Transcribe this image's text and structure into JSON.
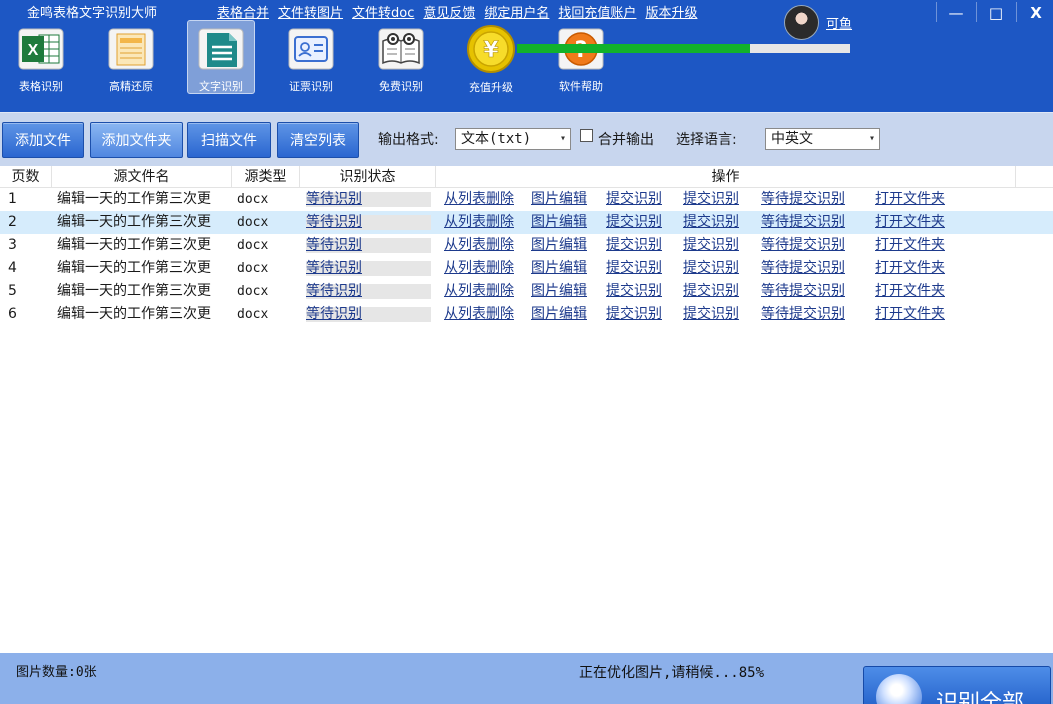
{
  "app_title": "金鸣表格文字识别大师",
  "top_links": [
    "表格合并",
    "文件转图片",
    "文件转doc",
    "意见反馈",
    "绑定用户名",
    "找回充值账户",
    "版本升级"
  ],
  "user": {
    "name": "可鱼"
  },
  "window_controls": {
    "minimize": "—",
    "maximize": "□",
    "close": "X"
  },
  "tools": [
    {
      "label": "表格识别",
      "icon": "excel-icon",
      "active": false
    },
    {
      "label": "高精还原",
      "icon": "layout-icon",
      "active": false
    },
    {
      "label": "文字识别",
      "icon": "document-icon",
      "active": true
    },
    {
      "label": "证票识别",
      "icon": "id-card-icon",
      "active": false
    },
    {
      "label": "免费识别",
      "icon": "book-icon",
      "active": false
    },
    {
      "label": "充值升级",
      "icon": "yen-coin-icon",
      "active": false
    },
    {
      "label": "软件帮助",
      "icon": "help-icon",
      "active": false
    }
  ],
  "actions": {
    "add_file": "添加文件",
    "add_folder": "添加文件夹",
    "scan_file": "扫描文件",
    "clear_list": "清空列表",
    "output_format_label": "输出格式:",
    "output_format_value": "文本(txt)",
    "merge_output_label": "合并输出",
    "language_label": "选择语言:",
    "language_value": "中英文"
  },
  "table": {
    "headers": [
      "页数",
      "源文件名",
      "源类型",
      "识别状态",
      "操作"
    ],
    "rows": [
      {
        "page": "1",
        "filename": "编辑一天的工作第三次更",
        "type": "docx",
        "status": "等待识别",
        "selected": false
      },
      {
        "page": "2",
        "filename": "编辑一天的工作第三次更",
        "type": "docx",
        "status": "等待识别",
        "selected": true
      },
      {
        "page": "3",
        "filename": "编辑一天的工作第三次更",
        "type": "docx",
        "status": "等待识别",
        "selected": false
      },
      {
        "page": "4",
        "filename": "编辑一天的工作第三次更",
        "type": "docx",
        "status": "等待识别",
        "selected": false
      },
      {
        "page": "5",
        "filename": "编辑一天的工作第三次更",
        "type": "docx",
        "status": "等待识别",
        "selected": false
      },
      {
        "page": "6",
        "filename": "编辑一天的工作第三次更",
        "type": "docx",
        "status": "等待识别",
        "selected": false
      }
    ],
    "row_actions": [
      "从列表删除",
      "图片编辑",
      "提交识别",
      "提交识别",
      "等待提交识别",
      "打开文件夹"
    ]
  },
  "status": {
    "image_count": "图片数量:0张",
    "progress_text": "正在优化图片,请稍候...85%",
    "progress_percent": 70,
    "recognize_all": "识别全部"
  },
  "colors": {
    "topbar": "#1d57c4",
    "actionbar": "#c8d6ee",
    "statusbar": "#8cb0ea",
    "selected_row": "#d6ecfc",
    "progress_fill": "#12b22a"
  }
}
